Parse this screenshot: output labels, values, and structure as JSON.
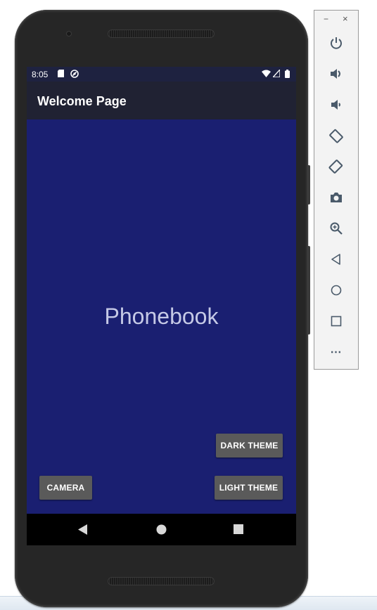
{
  "status_bar": {
    "time": "8:05"
  },
  "app_bar": {
    "title": "Welcome Page"
  },
  "content": {
    "heading": "Phonebook"
  },
  "buttons": {
    "dark_theme": "DARK THEME",
    "camera": "CAMERA",
    "light_theme": "LIGHT THEME"
  },
  "colors": {
    "screen_background": "#1a1f71",
    "status_bar": "#1e2240",
    "app_bar": "#202233",
    "button_background": "#5a5a5a",
    "heading_text": "#c5c9e6"
  },
  "nav_bar": {
    "icons": [
      "back-icon",
      "home-icon",
      "recents-icon"
    ]
  },
  "emulator_panel": {
    "window_controls": {
      "minimize": "−",
      "close": "×"
    },
    "more_label": "⋯",
    "icons": [
      "power-icon",
      "volume-up-icon",
      "volume-down-icon",
      "rotate-left-icon",
      "rotate-right-icon",
      "camera-icon",
      "zoom-icon",
      "back-icon",
      "home-icon",
      "overview-icon",
      "more-icon"
    ]
  }
}
